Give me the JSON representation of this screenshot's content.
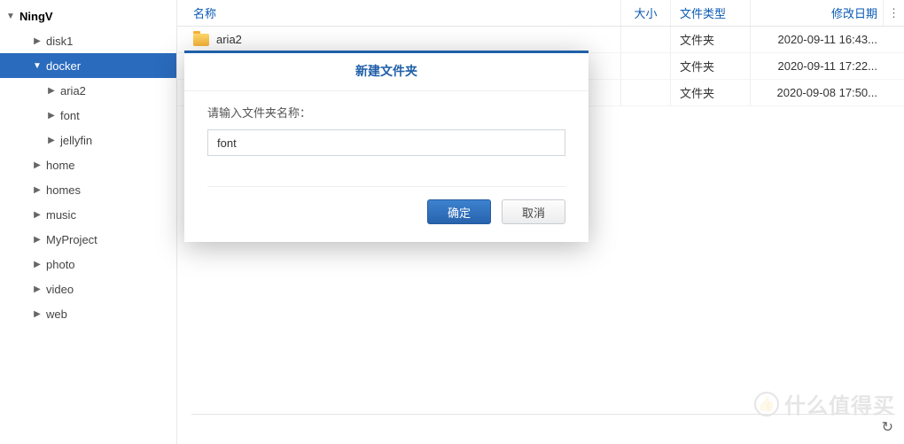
{
  "sidebar": {
    "root": "NingV",
    "nodes": [
      {
        "label": "disk1",
        "level": 1,
        "expanded": false,
        "selected": false
      },
      {
        "label": "docker",
        "level": 1,
        "expanded": true,
        "selected": true
      },
      {
        "label": "aria2",
        "level": 2,
        "expanded": false,
        "selected": false,
        "parent": "docker"
      },
      {
        "label": "font",
        "level": 2,
        "expanded": false,
        "selected": false,
        "parent": "docker"
      },
      {
        "label": "jellyfin",
        "level": 2,
        "expanded": false,
        "selected": false,
        "parent": "docker"
      },
      {
        "label": "home",
        "level": 1,
        "expanded": false,
        "selected": false
      },
      {
        "label": "homes",
        "level": 1,
        "expanded": false,
        "selected": false
      },
      {
        "label": "music",
        "level": 1,
        "expanded": false,
        "selected": false
      },
      {
        "label": "MyProject",
        "level": 1,
        "expanded": false,
        "selected": false
      },
      {
        "label": "photo",
        "level": 1,
        "expanded": false,
        "selected": false
      },
      {
        "label": "video",
        "level": 1,
        "expanded": false,
        "selected": false
      },
      {
        "label": "web",
        "level": 1,
        "expanded": false,
        "selected": false
      }
    ]
  },
  "table": {
    "headers": {
      "name": "名称",
      "size": "大小",
      "type": "文件类型",
      "date": "修改日期"
    },
    "rows": [
      {
        "name": "aria2",
        "size": "",
        "type": "文件夹",
        "date": "2020-09-11 16:43..."
      },
      {
        "name": "",
        "size": "",
        "type": "文件夹",
        "date": "2020-09-11 17:22..."
      },
      {
        "name": "",
        "size": "",
        "type": "文件夹",
        "date": "2020-09-08 17:50..."
      }
    ]
  },
  "dialog": {
    "title": "新建文件夹",
    "label": "请输入文件夹名称：",
    "value": "font",
    "ok": "确定",
    "cancel": "取消"
  },
  "watermark": "什么值得买"
}
